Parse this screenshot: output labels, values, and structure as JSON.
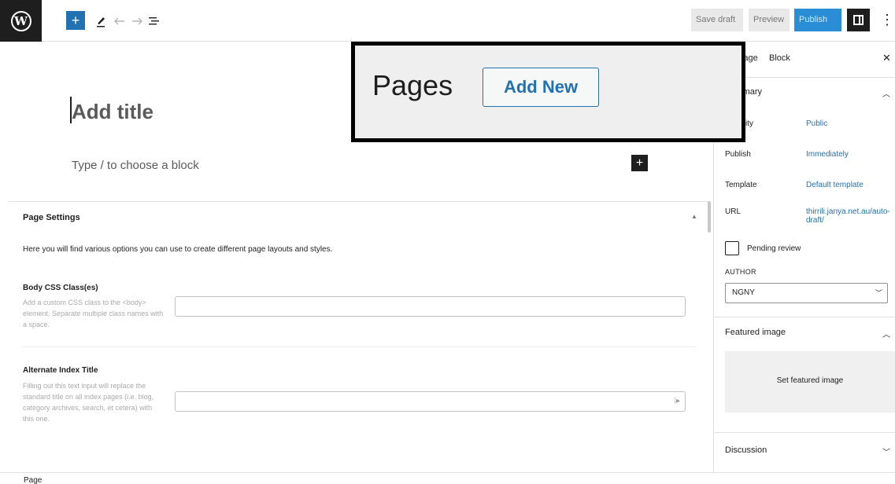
{
  "toolbar": {
    "logo_label": "W",
    "add_label": "+",
    "save_draft": "Save draft",
    "preview": "Preview",
    "publish": "Publish",
    "more": "⋮"
  },
  "editor": {
    "title_placeholder": "Add title",
    "block_placeholder": "Type / to choose a block",
    "inserter": "+"
  },
  "meta_box": {
    "header": "Page Settings",
    "description": "Here you will find various options you can use to create different page layouts and styles.",
    "fields": [
      {
        "label": "Body CSS Class(es)",
        "help": "Add a custom CSS class to the <body> element. Separate multiple class names with a space.",
        "value": ""
      },
      {
        "label": "Alternate Index Title",
        "help": "Filling out this text input will replace the standard title on all index pages (i.e. blog, category archives, search, et cetera) with this one.",
        "value": ""
      }
    ]
  },
  "sidebar": {
    "tabs": [
      "Page",
      "Block"
    ],
    "summary_title": "Summary",
    "rows": [
      {
        "label": "Visibility",
        "value": "Public"
      },
      {
        "label": "Publish",
        "value": "Immediately"
      },
      {
        "label": "Template",
        "value": "Default template"
      },
      {
        "label": "URL",
        "value": "thirrili.janya.net.au/auto-draft/"
      }
    ],
    "pending_review": "Pending review",
    "author_label": "AUTHOR",
    "author_value": "NGNY",
    "featured_image_title": "Featured image",
    "featured_image_button": "Set featured image",
    "discussion_title": "Discussion"
  },
  "footer": {
    "breadcrumb": "Page"
  },
  "callout": {
    "title": "Pages",
    "button": "Add New"
  },
  "colors": {
    "accent": "#2271b1",
    "publish_bg": "#2a8ed6",
    "dark": "#1e1e1e"
  }
}
